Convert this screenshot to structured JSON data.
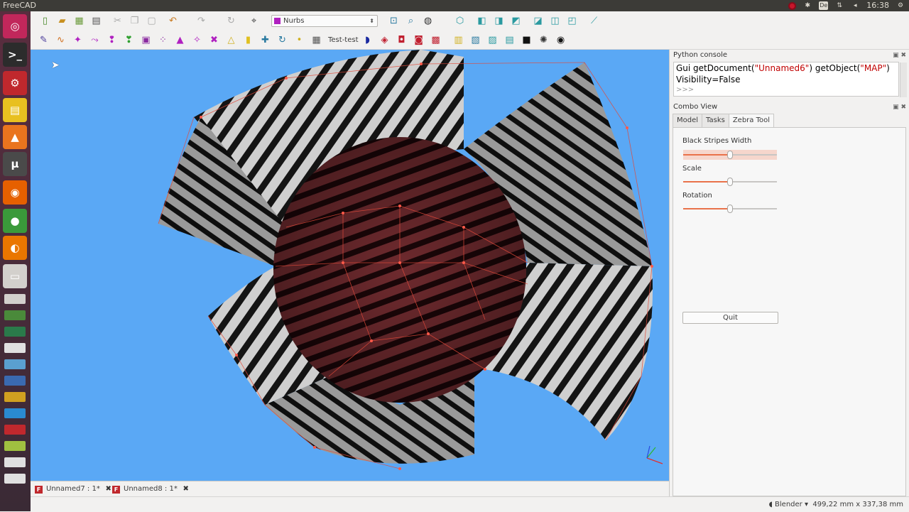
{
  "window": {
    "title": "FreeCAD"
  },
  "tray": {
    "keyboard": "De",
    "time": "16:38"
  },
  "launcher": {
    "items": [
      {
        "name": "ubuntu-dash-icon",
        "glyph": "◎",
        "color": "#c1275b"
      },
      {
        "name": "terminal-icon",
        "glyph": ">_",
        "color": "#2c2c2c"
      },
      {
        "name": "freecad-icon",
        "glyph": "⚙",
        "color": "#c0282d"
      },
      {
        "name": "ruler-icon",
        "glyph": "▤",
        "color": "#e8c020"
      },
      {
        "name": "vlc-icon",
        "glyph": "▲",
        "color": "#e9741e"
      },
      {
        "name": "mu-editor-icon",
        "glyph": "μ",
        "color": "#4a4a4a"
      },
      {
        "name": "firefox-icon",
        "glyph": "◉",
        "color": "#e66000"
      },
      {
        "name": "chrome-icon",
        "glyph": "●",
        "color": "#3a9a3a"
      },
      {
        "name": "blender-icon",
        "glyph": "◐",
        "color": "#ea7600"
      },
      {
        "name": "files-icon",
        "glyph": "▭",
        "color": "#d3d0cc"
      }
    ]
  },
  "toolbar": {
    "workbench": "Nurbs",
    "test_button": "Test-test"
  },
  "console": {
    "title": "Python console",
    "line1_a": "Gui getDocument(",
    "line1_str1": "\"Unnamed6\"",
    "line1_b": ") getObject(",
    "line1_str2": "\"MAP\"",
    "line1_c": ")",
    "line2": "Visibility=False",
    "prompt": ">>>"
  },
  "combo": {
    "title": "Combo View",
    "tabs": [
      "Model",
      "Tasks",
      "Zebra Tool"
    ],
    "active_tab": 2
  },
  "zebra": {
    "stripes_label": "Black Stripes Width",
    "stripes_value": 0.5,
    "scale_label": "Scale",
    "scale_value": 0.5,
    "rotation_label": "Rotation",
    "rotation_value": 0.5,
    "quit_label": "Quit"
  },
  "documents": [
    {
      "label": "Unnamed7 : 1*"
    },
    {
      "label": "Unnamed8 : 1*"
    }
  ],
  "status": {
    "nav_style": "Blender",
    "dimensions": "499,22 mm x 337,38 mm"
  },
  "colors": {
    "viewport_bg": "#5aa8f5",
    "accent": "#e9724a"
  }
}
